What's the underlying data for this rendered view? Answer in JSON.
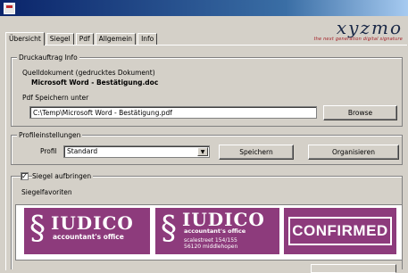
{
  "brand": {
    "name": "xyzmo",
    "tagline": "the next generation digital signature"
  },
  "tabs": [
    {
      "label": "Übersicht"
    },
    {
      "label": "Siegel"
    },
    {
      "label": "Pdf"
    },
    {
      "label": "Allgemein"
    },
    {
      "label": "Info"
    }
  ],
  "druckauftrag": {
    "legend": "Druckauftrag Info",
    "source_label": "Quelldokument (gedrucktes Dokument)",
    "source_value": "Microsoft Word - Bestätigung.doc",
    "save_label": "Pdf Speichern unter",
    "save_path": "C:\\Temp\\Microsoft Word - Bestätigung.pdf",
    "browse_label": "Browse"
  },
  "profile": {
    "legend": "Profileinstellungen",
    "profil_label": "Profil",
    "profil_value": "Standard",
    "save_label": "Speichern",
    "organize_label": "Organisieren"
  },
  "siegel": {
    "checkbox_label": "Siegel aufbringen",
    "checked": true,
    "favorites_label": "Siegelfavoriten",
    "items": [
      {
        "name": "IUDICO",
        "subtitle": "accountant's office"
      },
      {
        "name": "IUDICO",
        "subtitle": "accountant's office",
        "address1": "scalestreet 154/155",
        "address2": "56120 middlehopen"
      },
      {
        "text": "CONFIRMED"
      }
    ]
  },
  "colors": {
    "titlebar": "#0a246a",
    "seal": "#8d3b7c",
    "brand_red": "#a31d24"
  }
}
